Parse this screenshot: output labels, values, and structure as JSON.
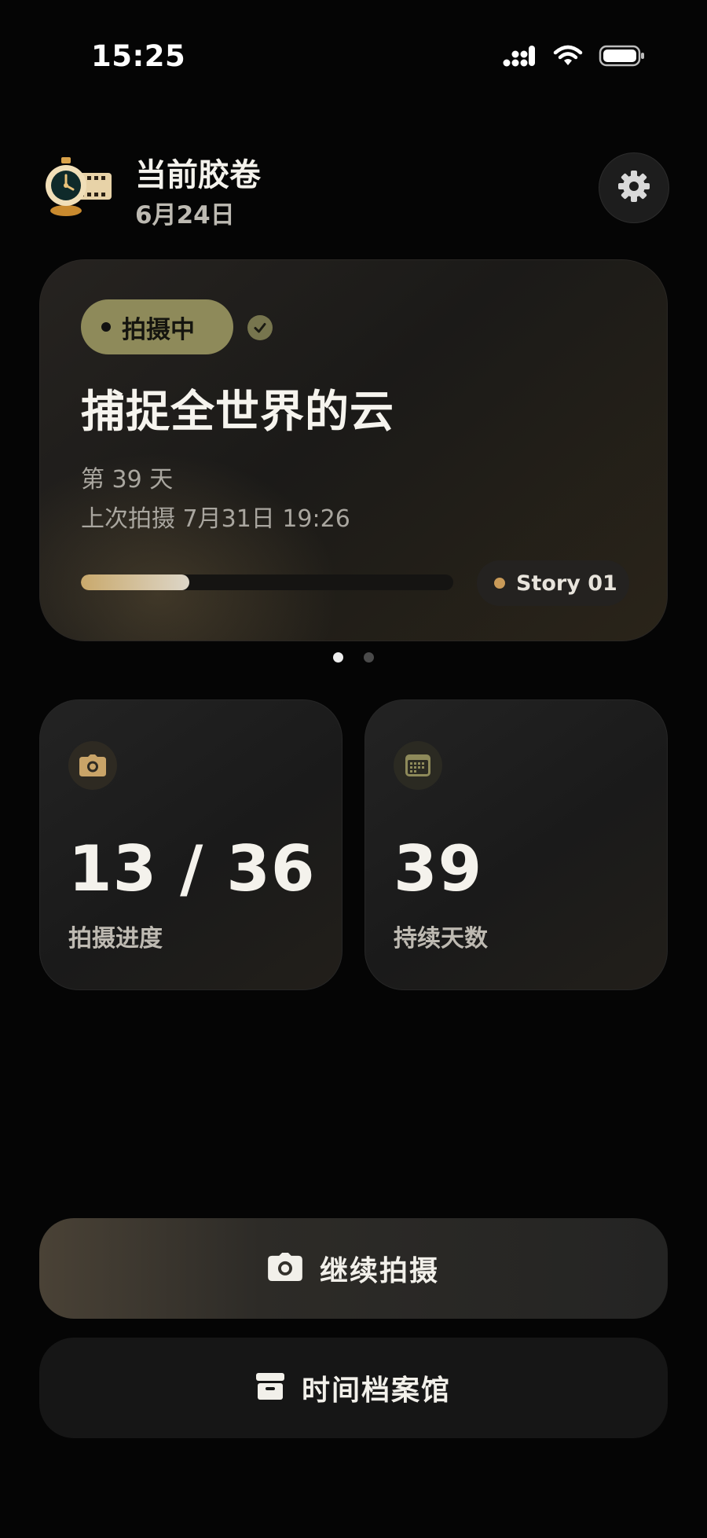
{
  "status_bar": {
    "time": "15:25",
    "icons": [
      "signal-icon",
      "wifi-icon",
      "battery-icon"
    ]
  },
  "header": {
    "title": "当前胶卷",
    "date": "6月24日",
    "logo_icon": "film-clock-logo",
    "settings_icon": "gear-icon"
  },
  "hero": {
    "status_label": "拍摄中",
    "status_color": "#8e8a5a",
    "verified_icon": "check-circle-icon",
    "title": "捕捉全世界的云",
    "day_text": "第 39 天",
    "last_shot_text": "上次拍摄 7月31日 19:26",
    "progress_fraction": 0.2917,
    "story_label": "Story 01",
    "story_dot_color": "#c99a58"
  },
  "pager": {
    "count": 2,
    "active_index": 0
  },
  "stats": [
    {
      "icon": "camera-icon",
      "value": "13 / 36",
      "label": "拍摄进度",
      "accent": "#c9a468"
    },
    {
      "icon": "calendar-icon",
      "value": "39",
      "label": "持续天数",
      "accent": "#8e8a5a"
    }
  ],
  "actions": {
    "continue_label": "继续拍摄",
    "continue_icon": "camera-icon",
    "archive_label": "时间档案馆",
    "archive_icon": "archive-box-icon"
  }
}
